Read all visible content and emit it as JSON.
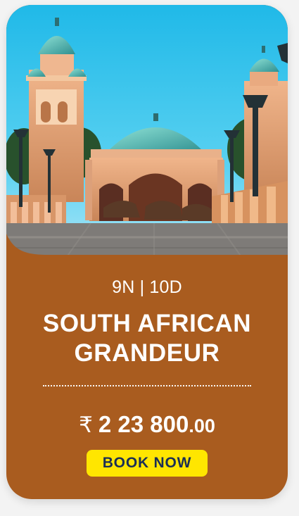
{
  "package": {
    "duration": "9N | 10D",
    "title_line1": "SOUTH AFRICAN",
    "title_line2": "GRANDEUR",
    "price": {
      "currency_symbol": "₹",
      "amount": "2 23 800",
      "decimals": ".00"
    },
    "book_button": "BOOK NOW"
  },
  "colors": {
    "card_bg": "#a95c1f",
    "button_bg": "#ffe600",
    "button_text": "#1b2f55",
    "text": "#ffffff"
  },
  "icons": {
    "currency": "rupee-icon"
  }
}
